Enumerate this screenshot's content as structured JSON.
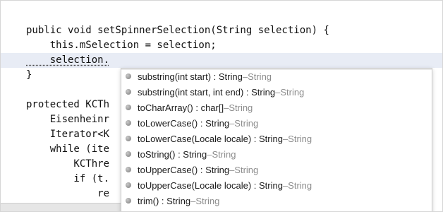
{
  "editor": {
    "lines": [
      {
        "text": "public void setSpinnerSelection(String selection) {"
      },
      {
        "text": "    this.mSelection = selection;"
      },
      {
        "text": "    selection."
      },
      {
        "text": "}"
      },
      {
        "text": ""
      },
      {
        "text": "protected KCTh"
      },
      {
        "text": "    Eisenheinr"
      },
      {
        "text": "    Iterator<K"
      },
      {
        "text": "    while (ite"
      },
      {
        "text": "        KCThre"
      },
      {
        "text": "        if (t."
      },
      {
        "text": "            re"
      },
      {
        "text": "        }"
      }
    ]
  },
  "autocomplete": {
    "items": [
      {
        "signature": "substring(int start) : String",
        "separator": " – ",
        "owner": "String"
      },
      {
        "signature": "substring(int start, int end) : String",
        "separator": " – ",
        "owner": "String"
      },
      {
        "signature": "toCharArray() : char[]",
        "separator": " – ",
        "owner": "String"
      },
      {
        "signature": "toLowerCase() : String",
        "separator": " – ",
        "owner": "String"
      },
      {
        "signature": "toLowerCase(Locale locale) : String",
        "separator": " – ",
        "owner": "String"
      },
      {
        "signature": "toString() : String",
        "separator": " – ",
        "owner": "String"
      },
      {
        "signature": "toUpperCase() : String",
        "separator": " – ",
        "owner": "String"
      },
      {
        "signature": "toUpperCase(Locale locale) : String",
        "separator": " – ",
        "owner": "String"
      },
      {
        "signature": "trim() : String",
        "separator": " – ",
        "owner": "String"
      }
    ]
  }
}
